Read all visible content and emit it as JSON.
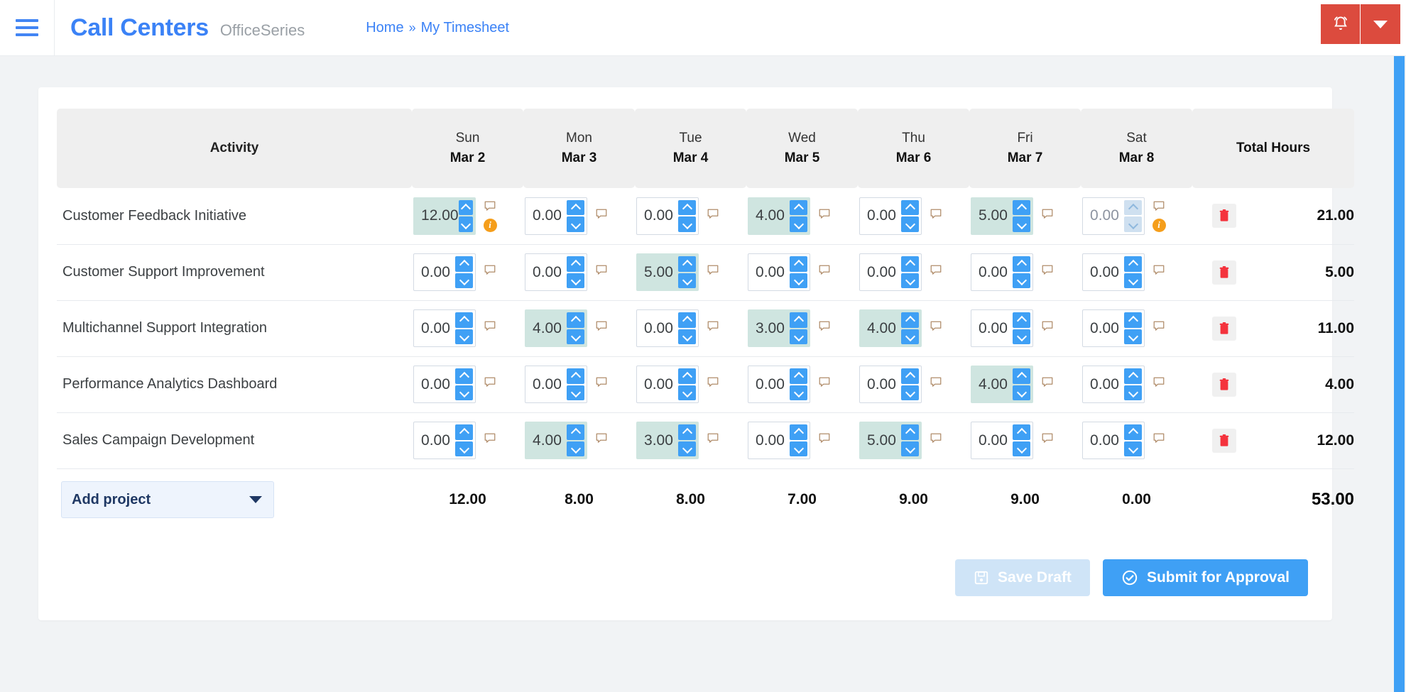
{
  "header": {
    "menu_icon": "hamburger-icon",
    "brand_title": "Call Centers",
    "brand_subtitle": "OfficeSeries",
    "breadcrumb": {
      "home": "Home",
      "separator": "»",
      "current": "My Timesheet"
    },
    "alarm_icon": "alarm-bell-icon",
    "caret_icon": "chevron-down-icon",
    "alarm_color": "#dc4b3e",
    "brand_color": "#3b82f6"
  },
  "table": {
    "activity_header": "Activity",
    "total_header": "Total Hours",
    "days": [
      {
        "day": "Sun",
        "date": "Mar 2"
      },
      {
        "day": "Mon",
        "date": "Mar 3"
      },
      {
        "day": "Tue",
        "date": "Mar 4"
      },
      {
        "day": "Wed",
        "date": "Mar 5"
      },
      {
        "day": "Thu",
        "date": "Mar 6"
      },
      {
        "day": "Fri",
        "date": "Mar 7"
      },
      {
        "day": "Sat",
        "date": "Mar 8"
      }
    ],
    "rows": [
      {
        "activity": "Customer Feedback Initiative",
        "total": "21.00",
        "cells": [
          {
            "value": "12.00",
            "filled": true,
            "disabled": false,
            "info": true
          },
          {
            "value": "0.00",
            "filled": false,
            "disabled": false,
            "info": false
          },
          {
            "value": "0.00",
            "filled": false,
            "disabled": false,
            "info": false
          },
          {
            "value": "4.00",
            "filled": true,
            "disabled": false,
            "info": false
          },
          {
            "value": "0.00",
            "filled": false,
            "disabled": false,
            "info": false
          },
          {
            "value": "5.00",
            "filled": true,
            "disabled": false,
            "info": false
          },
          {
            "value": "0.00",
            "filled": false,
            "disabled": true,
            "info": true
          }
        ]
      },
      {
        "activity": "Customer Support Improvement",
        "total": "5.00",
        "cells": [
          {
            "value": "0.00",
            "filled": false,
            "disabled": false,
            "info": false
          },
          {
            "value": "0.00",
            "filled": false,
            "disabled": false,
            "info": false
          },
          {
            "value": "5.00",
            "filled": true,
            "disabled": false,
            "info": false
          },
          {
            "value": "0.00",
            "filled": false,
            "disabled": false,
            "info": false
          },
          {
            "value": "0.00",
            "filled": false,
            "disabled": false,
            "info": false
          },
          {
            "value": "0.00",
            "filled": false,
            "disabled": false,
            "info": false
          },
          {
            "value": "0.00",
            "filled": false,
            "disabled": false,
            "info": false
          }
        ]
      },
      {
        "activity": "Multichannel Support Integration",
        "total": "11.00",
        "cells": [
          {
            "value": "0.00",
            "filled": false,
            "disabled": false,
            "info": false
          },
          {
            "value": "4.00",
            "filled": true,
            "disabled": false,
            "info": false
          },
          {
            "value": "0.00",
            "filled": false,
            "disabled": false,
            "info": false
          },
          {
            "value": "3.00",
            "filled": true,
            "disabled": false,
            "info": false
          },
          {
            "value": "4.00",
            "filled": true,
            "disabled": false,
            "info": false
          },
          {
            "value": "0.00",
            "filled": false,
            "disabled": false,
            "info": false
          },
          {
            "value": "0.00",
            "filled": false,
            "disabled": false,
            "info": false
          }
        ]
      },
      {
        "activity": "Performance Analytics Dashboard",
        "total": "4.00",
        "cells": [
          {
            "value": "0.00",
            "filled": false,
            "disabled": false,
            "info": false
          },
          {
            "value": "0.00",
            "filled": false,
            "disabled": false,
            "info": false
          },
          {
            "value": "0.00",
            "filled": false,
            "disabled": false,
            "info": false
          },
          {
            "value": "0.00",
            "filled": false,
            "disabled": false,
            "info": false
          },
          {
            "value": "0.00",
            "filled": false,
            "disabled": false,
            "info": false
          },
          {
            "value": "4.00",
            "filled": true,
            "disabled": false,
            "info": false
          },
          {
            "value": "0.00",
            "filled": false,
            "disabled": false,
            "info": false
          }
        ]
      },
      {
        "activity": "Sales Campaign Development",
        "total": "12.00",
        "cells": [
          {
            "value": "0.00",
            "filled": false,
            "disabled": false,
            "info": false
          },
          {
            "value": "4.00",
            "filled": true,
            "disabled": false,
            "info": false
          },
          {
            "value": "3.00",
            "filled": true,
            "disabled": false,
            "info": false
          },
          {
            "value": "0.00",
            "filled": false,
            "disabled": false,
            "info": false
          },
          {
            "value": "5.00",
            "filled": true,
            "disabled": false,
            "info": false
          },
          {
            "value": "0.00",
            "filled": false,
            "disabled": false,
            "info": false
          },
          {
            "value": "0.00",
            "filled": false,
            "disabled": false,
            "info": false
          }
        ]
      }
    ],
    "day_totals": [
      "12.00",
      "8.00",
      "8.00",
      "7.00",
      "9.00",
      "9.00",
      "0.00"
    ],
    "grand_total": "53.00",
    "add_project_label": "Add project",
    "row_menu_icon": "ellipsis-icon",
    "delete_icon": "trash-icon",
    "note_icon": "comment-icon",
    "info_icon": "info-badge-icon",
    "filled_cell_color": "#cfe5e0",
    "spinner_color": "#3fa0f5",
    "info_color": "#f59e1b",
    "delete_color": "#f4333d"
  },
  "actions": {
    "save_draft_label": "Save Draft",
    "save_draft_icon": "floppy-disk-icon",
    "submit_label": "Submit for Approval",
    "submit_icon": "check-circle-icon"
  }
}
